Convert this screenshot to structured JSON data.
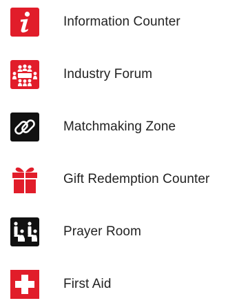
{
  "legend": {
    "items": [
      {
        "id": "information",
        "label": "Information Counter",
        "icon": "info-icon",
        "color": "#e11d2a"
      },
      {
        "id": "forum",
        "label": "Industry Forum",
        "icon": "conference-table-icon",
        "color": "#e11d2a"
      },
      {
        "id": "matchmaking",
        "label": "Matchmaking Zone",
        "icon": "chain-link-icon",
        "color": "#111111"
      },
      {
        "id": "gift",
        "label": "Gift Redemption Counter",
        "icon": "gift-box-icon",
        "color": "#e11d2a"
      },
      {
        "id": "prayer",
        "label": "Prayer Room",
        "icon": "prayer-icon",
        "color": "#111111"
      },
      {
        "id": "firstaid",
        "label": "First Aid",
        "icon": "first-aid-cross-icon",
        "color": "#e11d2a"
      }
    ]
  }
}
